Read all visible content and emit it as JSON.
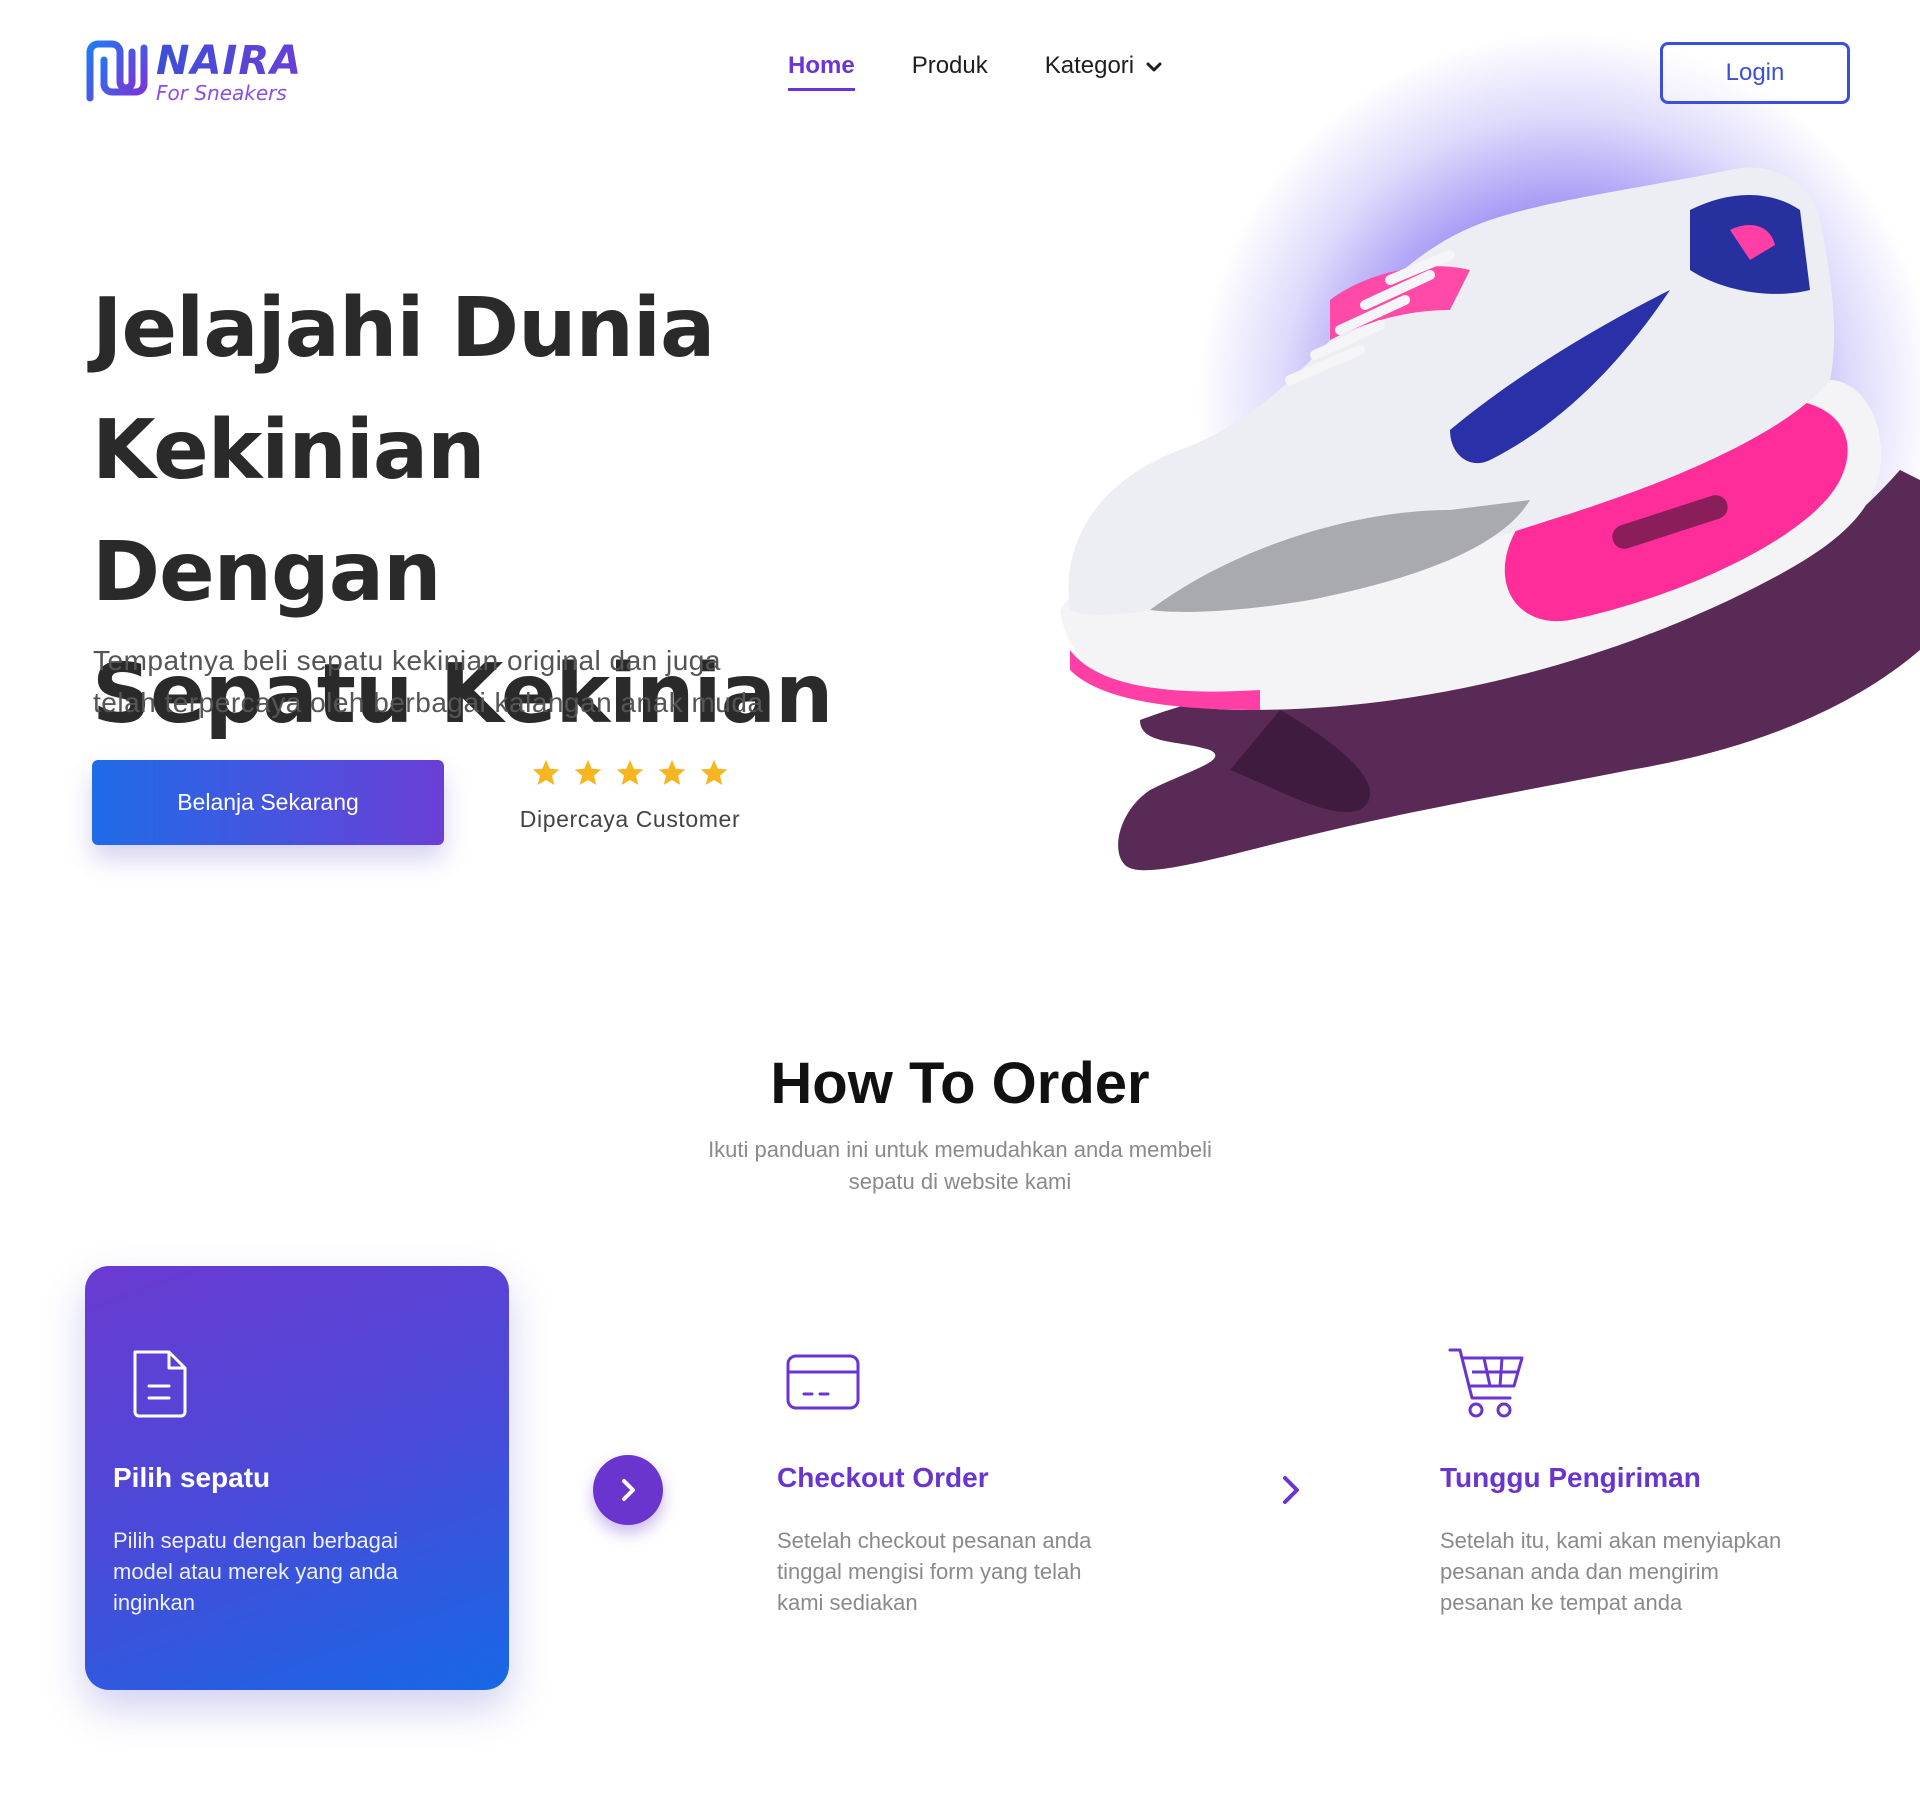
{
  "brand": {
    "name": "NAIRA",
    "tagline": "For Sneakers",
    "accent": "#6a35d6",
    "blue": "#3b50d6"
  },
  "nav": {
    "items": [
      {
        "label": "Home",
        "active": true
      },
      {
        "label": "Produk"
      },
      {
        "label": "Kategori",
        "icon": "chevron-down-icon"
      }
    ]
  },
  "login": {
    "label": "Login"
  },
  "hero": {
    "title_lines": [
      "Jelajahi Dunia",
      "Kekinian Dengan",
      "Sepatu Kekinian"
    ],
    "desc_lines": [
      "Tempatnya beli sepatu kekinian original dan juga",
      "telah terpercaya oleh berbagai kalangan anak muda"
    ],
    "cta": "Belanja Sekarang",
    "rating": {
      "stars": 5,
      "label": "Dipercaya Customer"
    },
    "image": "sneaker-on-hand"
  },
  "how_to_order": {
    "title": "How To Order",
    "subtitle_lines": [
      "Ikuti panduan ini untuk memudahkan anda membeli",
      "sepatu di website kami"
    ],
    "steps": [
      {
        "icon": "document-icon",
        "title": "Pilih sepatu",
        "desc_lines": [
          "Pilih sepatu dengan berbagai",
          "model atau merek yang anda",
          "inginkan"
        ]
      },
      {
        "icon": "credit-card-icon",
        "title": "Checkout Order",
        "desc_lines": [
          "Setelah checkout pesanan anda",
          "tinggal mengisi form yang telah",
          "kami sediakan"
        ]
      },
      {
        "icon": "shopping-cart-icon",
        "title": "Tunggu Pengiriman",
        "desc_lines": [
          "Setelah itu, kami akan menyiapkan",
          "pesanan anda dan mengirim",
          "pesanan ke tempat anda"
        ]
      }
    ]
  }
}
